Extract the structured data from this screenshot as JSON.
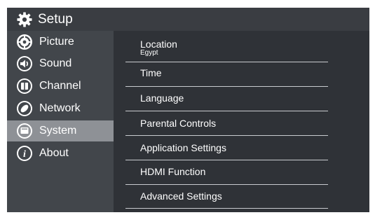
{
  "header": {
    "title": "Setup",
    "icon": "gear-icon"
  },
  "sidebar": {
    "items": [
      {
        "label": "Picture",
        "icon": "picture-settings-icon",
        "selected": false
      },
      {
        "label": "Sound",
        "icon": "speaker-icon",
        "selected": false
      },
      {
        "label": "Channel",
        "icon": "channel-icon",
        "selected": false
      },
      {
        "label": "Network",
        "icon": "network-icon",
        "selected": false
      },
      {
        "label": "System",
        "icon": "system-icon",
        "selected": true
      },
      {
        "label": "About",
        "icon": "info-icon",
        "selected": false
      }
    ]
  },
  "menu": {
    "items": [
      {
        "label": "Location",
        "value": "Egypt"
      },
      {
        "label": "Time"
      },
      {
        "label": "Language"
      },
      {
        "label": "Parental Controls"
      },
      {
        "label": "Application Settings"
      },
      {
        "label": "HDMI Function"
      },
      {
        "label": "Advanced Settings"
      }
    ]
  },
  "colors": {
    "background": "#3a3d42",
    "sidebar": "#42464b",
    "selected": "#8e9196",
    "content": "#2f3237",
    "text": "#ffffff"
  }
}
